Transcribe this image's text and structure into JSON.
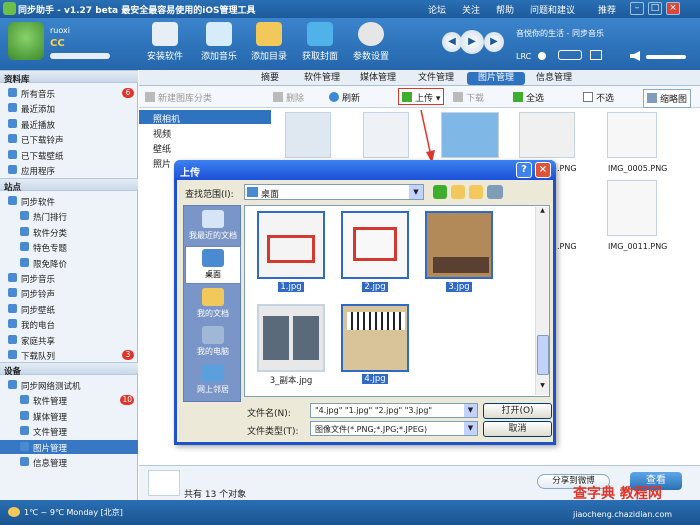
{
  "app": {
    "title": "同步助手 - v1.27 beta  最安全最容易使用的iOS管理工具",
    "links": [
      "论坛",
      "关注",
      "帮助",
      "问题和建议",
      "推荐"
    ]
  },
  "user": {
    "name": "ruoxi",
    "level": "CC"
  },
  "tools": [
    "安装软件",
    "添加音乐",
    "添加目录",
    "获取封面",
    "参数设置"
  ],
  "player": {
    "song": "音悦你的生活 - 同步音乐",
    "lrc": "LRC"
  },
  "sidebar": {
    "library_header": "资料库",
    "library": [
      {
        "label": "所有音乐",
        "badge": "6"
      },
      {
        "label": "最近添加",
        "badge": ""
      },
      {
        "label": "最近播放",
        "badge": ""
      },
      {
        "label": "已下载铃声",
        "badge": ""
      },
      {
        "label": "已下载壁纸",
        "badge": ""
      },
      {
        "label": "应用程序",
        "badge": ""
      }
    ],
    "station_header": "站点",
    "station": [
      {
        "label": "同步软件",
        "badge": "",
        "indent": 0
      },
      {
        "label": "热门排行",
        "badge": "",
        "indent": 1
      },
      {
        "label": "软件分类",
        "badge": "",
        "indent": 1
      },
      {
        "label": "特色专题",
        "badge": "",
        "indent": 1
      },
      {
        "label": "限免降价",
        "badge": "",
        "indent": 1
      },
      {
        "label": "同步音乐",
        "badge": "",
        "indent": 0
      },
      {
        "label": "同步铃声",
        "badge": "",
        "indent": 0
      },
      {
        "label": "同步壁纸",
        "badge": "",
        "indent": 0
      },
      {
        "label": "我的电台",
        "badge": "",
        "indent": 0
      },
      {
        "label": "家庭共享",
        "badge": "",
        "indent": 0
      },
      {
        "label": "下载队列",
        "badge": "3",
        "indent": 0
      }
    ],
    "device_header": "设备",
    "device": [
      {
        "label": "同步网络测试机",
        "badge": "",
        "indent": 0
      },
      {
        "label": "软件管理",
        "badge": "10",
        "indent": 1
      },
      {
        "label": "媒体管理",
        "badge": "",
        "indent": 1
      },
      {
        "label": "文件管理",
        "badge": "",
        "indent": 1
      },
      {
        "label": "图片管理",
        "badge": "",
        "indent": 1
      },
      {
        "label": "信息管理",
        "badge": "",
        "indent": 1
      }
    ],
    "selected": "图片管理"
  },
  "tabs": [
    "摘要",
    "软件管理",
    "媒体管理",
    "文件管理",
    "图片管理",
    "信息管理"
  ],
  "active_tab": "图片管理",
  "toolbar": {
    "new_category": "新建图库分类",
    "delete": "删除",
    "refresh": "刷新",
    "upload": "上传",
    "download": "下载",
    "select_all": "全选",
    "deselect": "不选",
    "thumbnail": "缩略图"
  },
  "albums": [
    "照相机",
    "视频",
    "壁纸",
    "照片"
  ],
  "photo_captions": [
    ".PNG",
    "IMG_0005.PNG",
    ".PNG",
    "IMG_0011.PNG"
  ],
  "status": {
    "count": "共有 13 个对象",
    "share": "分享到微博",
    "view": "查看"
  },
  "weather": "1℃ ~ 9℃   Monday   [北京]",
  "watermark": {
    "main": "查字典 教程网",
    "sub": "jiaocheng.chazidian.com"
  },
  "dialog": {
    "title": "上传",
    "look_in_label": "查找范围(I):",
    "look_in_value": "桌面",
    "places": [
      "我最近的文档",
      "桌面",
      "我的文档",
      "我的电脑",
      "网上邻居"
    ],
    "selected_place": "桌面",
    "files": [
      {
        "name": "1.jpg",
        "selected": true
      },
      {
        "name": "2.jpg",
        "selected": true
      },
      {
        "name": "3.jpg",
        "selected": true
      },
      {
        "name": "3_副本.jpg",
        "selected": false
      },
      {
        "name": "4.jpg",
        "selected": true
      }
    ],
    "filename_label": "文件名(N):",
    "filename_value": "\"4.jpg\" \"1.jpg\" \"2.jpg\" \"3.jpg\"",
    "filetype_label": "文件类型(T):",
    "filetype_value": "图像文件(*.PNG;*.JPG;*.JPEG)",
    "open_button": "打开(O)",
    "cancel_button": "取消"
  }
}
